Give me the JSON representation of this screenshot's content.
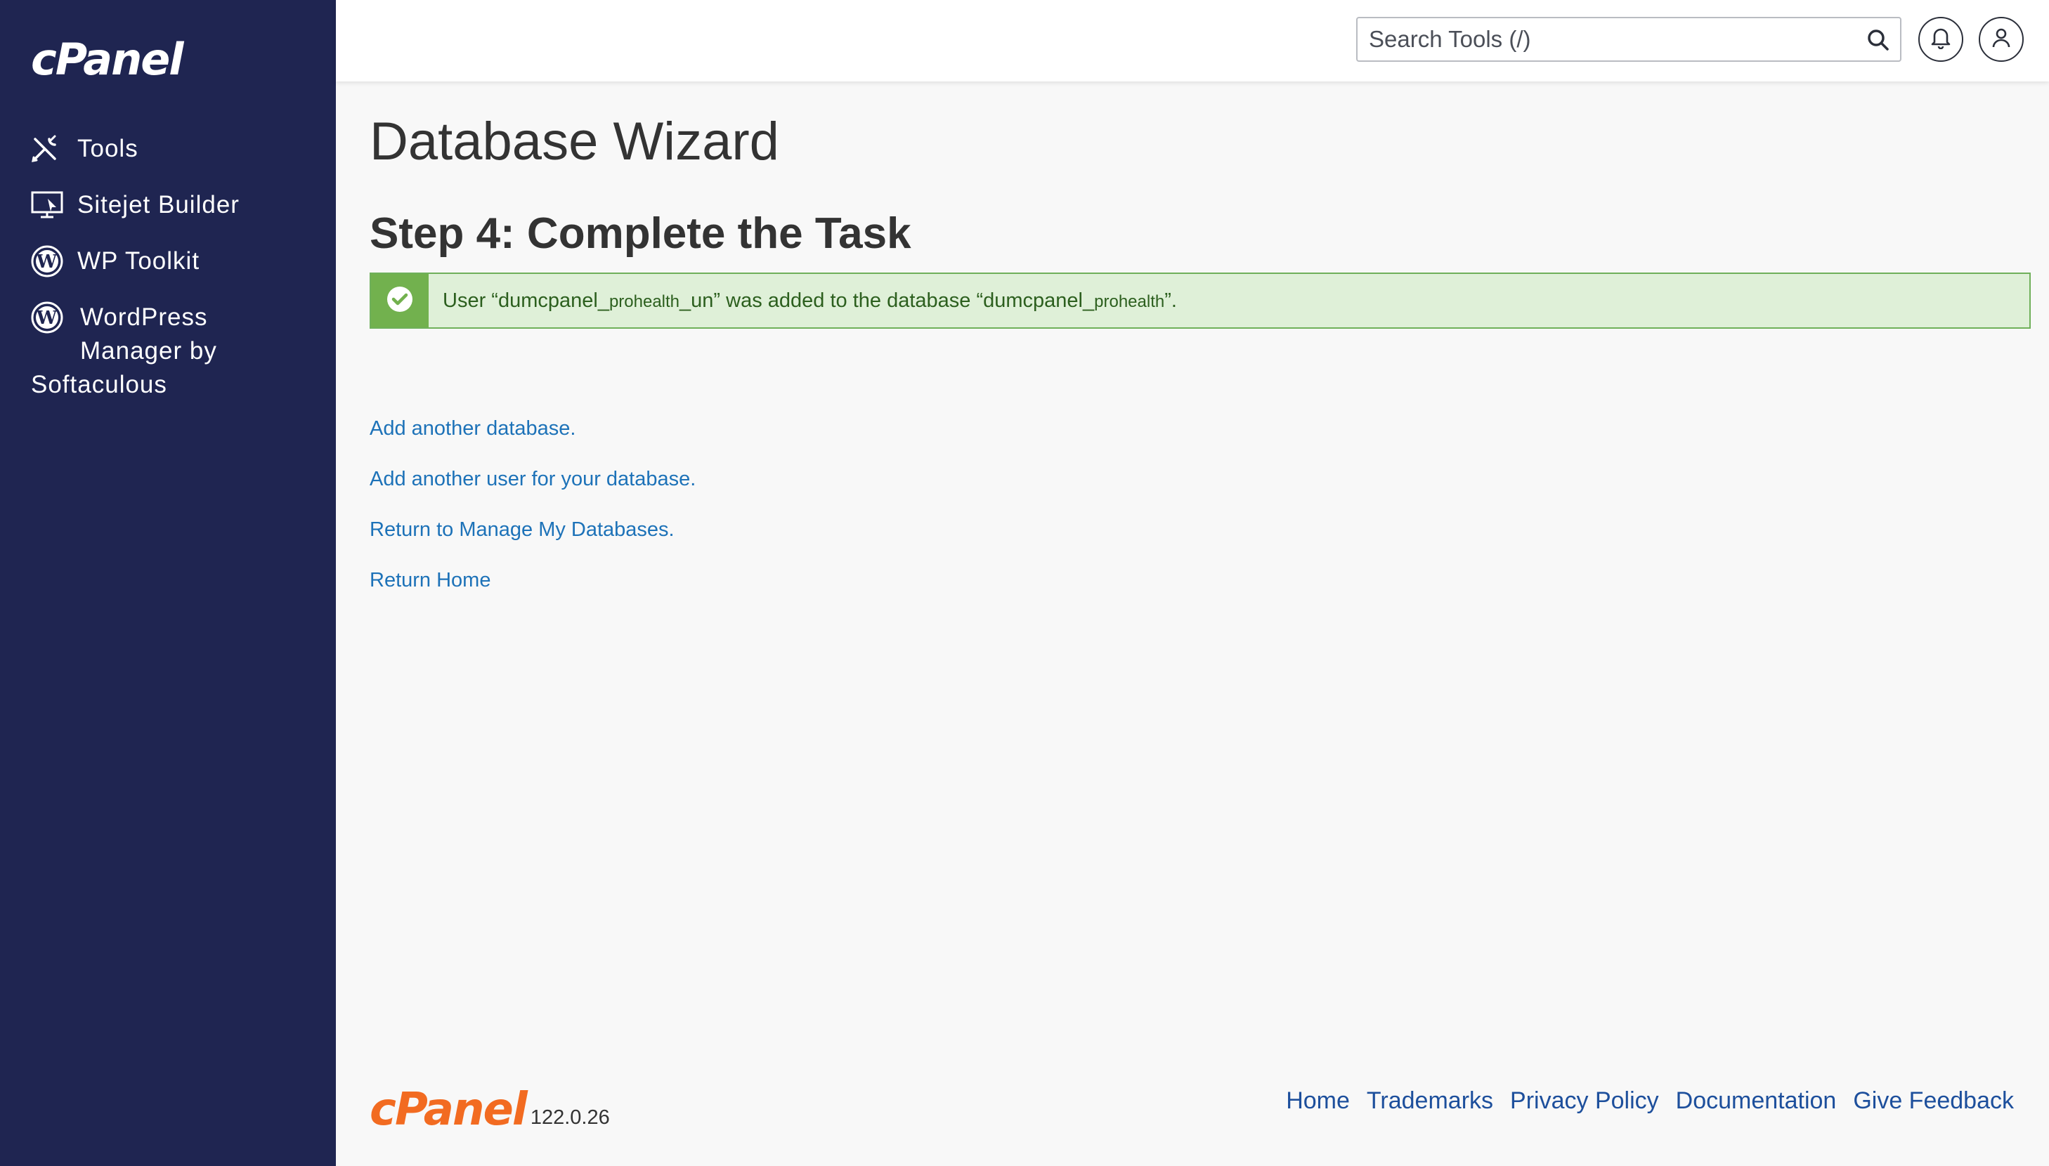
{
  "sidebar": {
    "logo": "cPanel",
    "items": [
      {
        "label": "Tools",
        "icon": "tools-icon"
      },
      {
        "label": "Sitejet Builder",
        "icon": "sitejet-icon"
      },
      {
        "label": "WP Toolkit",
        "icon": "wordpress-icon"
      },
      {
        "label_line1": "WordPress",
        "label_line2": "Manager by",
        "label_line3": "Softaculous",
        "icon": "wordpress-icon"
      }
    ]
  },
  "header": {
    "search_placeholder": "Search Tools (/)"
  },
  "main": {
    "title": "Database Wizard",
    "step_title": "Step 4: Complete the Task",
    "alert": {
      "p1": "User “dumcpanel_",
      "p2": "prohealth",
      "p3": "_un” was added to the database “dumcpanel_",
      "p4": "prohealth",
      "p5": "”."
    },
    "links": [
      "Add another database.",
      "Add another user for your database.",
      "Return to Manage My Databases.",
      "Return Home"
    ]
  },
  "footer": {
    "brand": "cPanel",
    "version": "122.0.26",
    "links": [
      "Home",
      "Trademarks",
      "Privacy Policy",
      "Documentation",
      "Give Feedback"
    ]
  },
  "colors": {
    "sidebar_bg": "#1f2551",
    "accent_orange": "#f26b21",
    "link_blue": "#1d72b8",
    "alert_bg": "#dff0d8",
    "alert_icon_bg": "#72b14e"
  }
}
